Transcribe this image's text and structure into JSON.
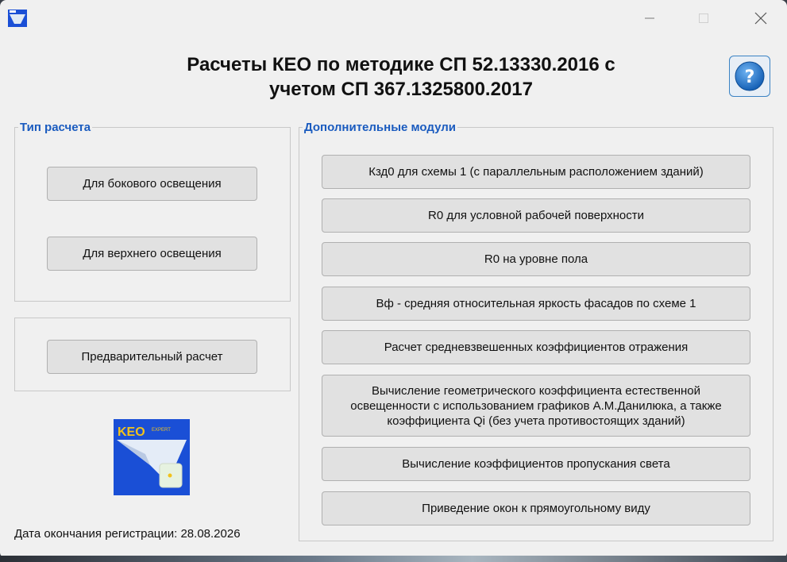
{
  "window": {
    "title": "Расчеты КЕО по методике СП 52.13330.2016 с учетом СП 367.1325800.2017",
    "title_line1": "Расчеты КЕО по методике СП 52.13330.2016 с",
    "title_line2": "учетом СП 367.1325800.2017",
    "controls": [
      "minimize-icon",
      "maximize-icon",
      "close-icon"
    ]
  },
  "calc_type": {
    "legend": "Тип расчета",
    "side_light_label": "Для бокового освещения",
    "top_light_label": "Для верхнего освещения"
  },
  "prelim": {
    "button_label": "Предварительный расчет"
  },
  "modules": {
    "legend": "Дополнительные модули",
    "items": [
      {
        "label": "Кзд0 для схемы 1 (с параллельным расположением зданий)"
      },
      {
        "label": "R0 для условной рабочей поверхности"
      },
      {
        "label": "R0 на уровне пола"
      },
      {
        "label": "Вф - средняя относительная яркость фасадов по схеме 1"
      },
      {
        "label": "Расчет средневзвешенных коэффициентов отражения"
      },
      {
        "label": "Вычисление геометрического коэффициента естественной освещенности с использованием графиков А.М.Данилюка, а также коэффициента Qi (без учета противостоящих зданий)"
      },
      {
        "label": "Вычисление коэффициентов пропускания света"
      },
      {
        "label": "Приведение окон к прямоугольному виду"
      }
    ]
  },
  "logo": {
    "text": "KEO",
    "subtext": "EXPERT",
    "colors": {
      "background": "#1a4fd6",
      "text": "#f2c21b"
    }
  },
  "registration": {
    "label": "Дата окончания регистрации: 28.08.2026"
  },
  "colors": {
    "legend": "#1a5bbf",
    "window_bg": "#f0f0f0",
    "button_bg": "#e1e1e1"
  }
}
